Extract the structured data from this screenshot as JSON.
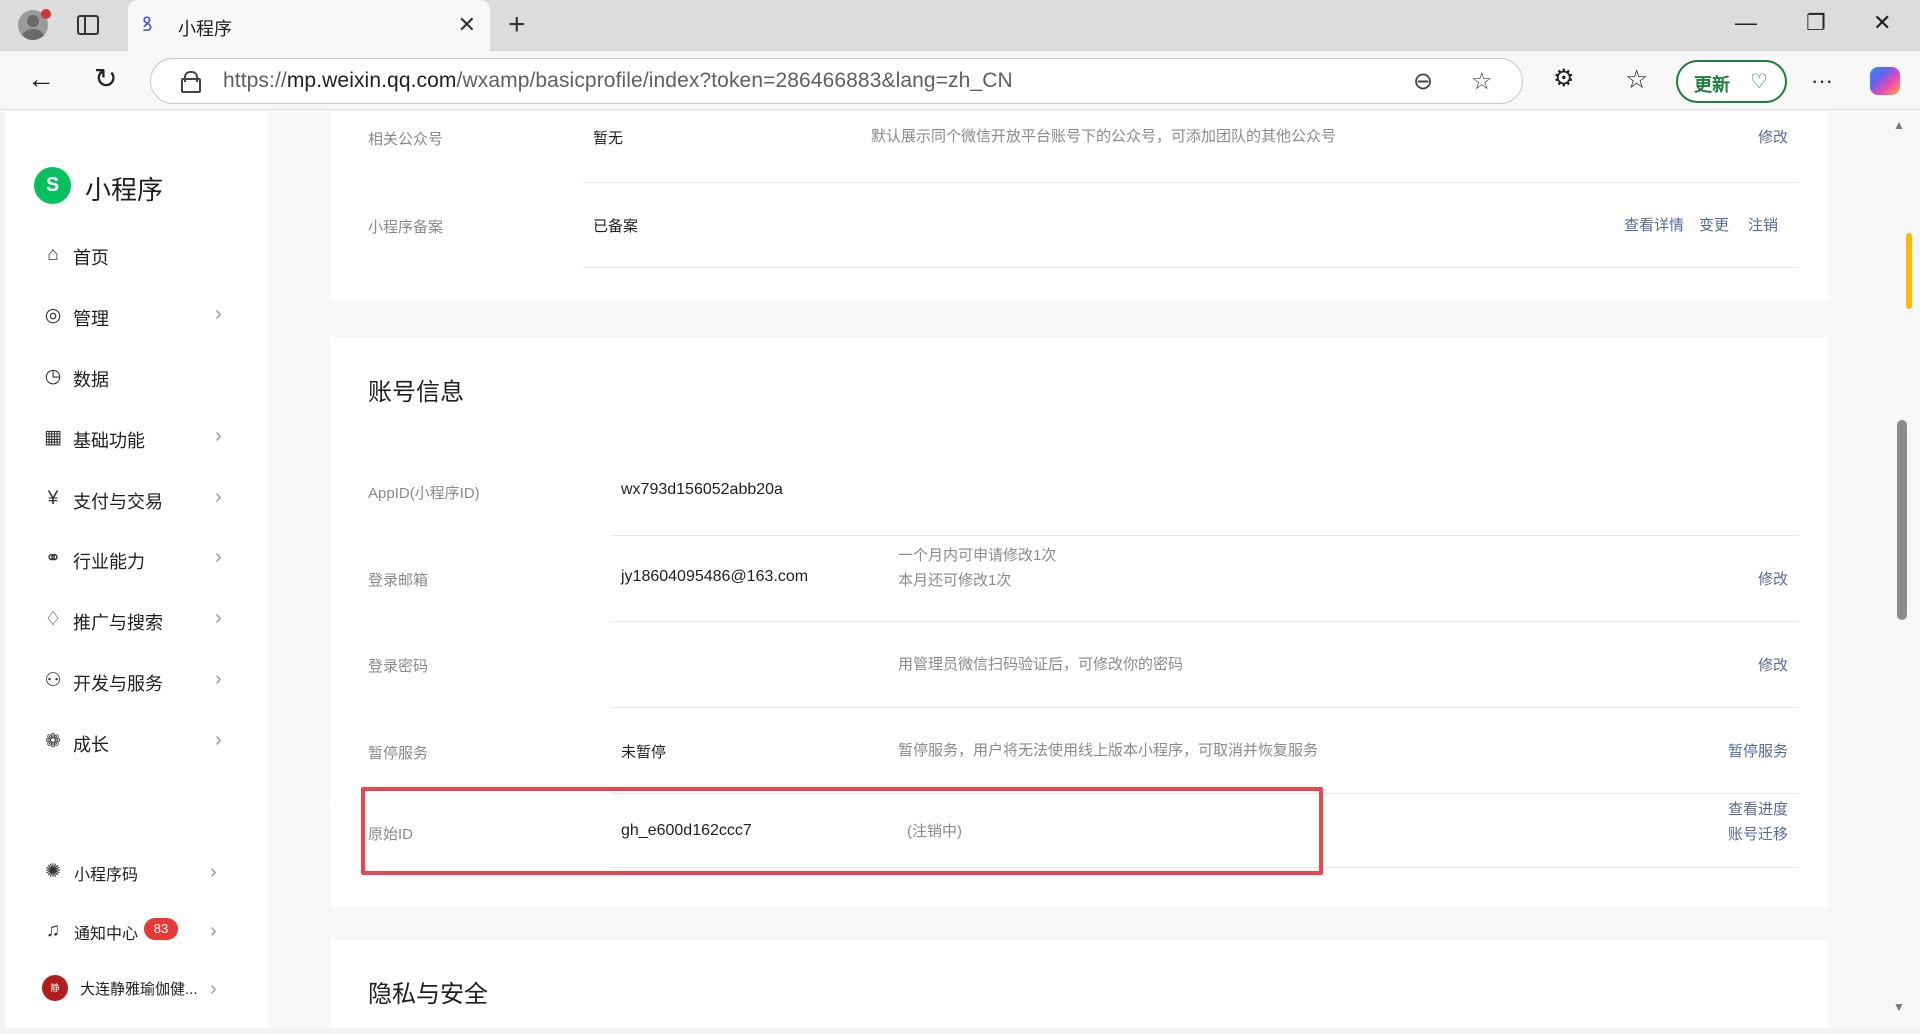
{
  "browser": {
    "tab_title": "小程序",
    "url_prefix": "https://",
    "url_host": "mp.weixin.qq.com",
    "url_path": "/wxamp/basicprofile/index?token=286466883&lang=zh_CN",
    "update_label": "更新",
    "favicon": "ꝸ",
    "close_glyph": "✕",
    "new_tab_glyph": "+",
    "minimize_glyph": "—",
    "restore_glyph": "❐",
    "window_close_glyph": "✕",
    "back_glyph": "←",
    "reload_glyph": "↻",
    "zoom_glyph": "⊖",
    "star_glyph": "☆",
    "extensions_glyph": "⚙",
    "favorites_glyph": "☆",
    "update_icon_glyph": "♡",
    "more_glyph": "···"
  },
  "sidebar": {
    "app_name": "小程序",
    "logo_glyph": "S",
    "items": [
      {
        "label": "首页",
        "icon": "⌂",
        "chevron": ""
      },
      {
        "label": "管理",
        "icon": "◎",
        "chevron": "›"
      },
      {
        "label": "数据",
        "icon": "◷",
        "chevron": ""
      },
      {
        "label": "基础功能",
        "icon": "▦",
        "chevron": "›"
      },
      {
        "label": "支付与交易",
        "icon": "¥",
        "chevron": "›"
      },
      {
        "label": "行业能力",
        "icon": "⚭",
        "chevron": "›"
      },
      {
        "label": "推广与搜索",
        "icon": "♢",
        "chevron": "›"
      },
      {
        "label": "开发与服务",
        "icon": "⚇",
        "chevron": "›"
      },
      {
        "label": "成长",
        "icon": "❁",
        "chevron": "›"
      }
    ],
    "bottom": {
      "qrcode_label": "小程序码",
      "qrcode_icon": "✺",
      "notify_label": "通知中心",
      "notify_icon": "♫",
      "notify_count": "83",
      "account_label": "大连静雅瑜伽健...",
      "account_avatar": "静",
      "chevron": "›"
    }
  },
  "related": {
    "rows": [
      {
        "label": "相关公众号",
        "value": "暂无",
        "desc": "默认展示同个微信开放平台账号下的公众号，可添加团队的其他公众号",
        "link": "修改"
      },
      {
        "label": "小程序备案",
        "value": "已备案",
        "links": [
          "查看详情",
          "变更",
          "注销"
        ]
      }
    ]
  },
  "account": {
    "title": "账号信息",
    "appid_label": "AppID(小程序ID)",
    "appid_value": "wx793d156052abb20a",
    "email_label": "登录邮箱",
    "email_value": "jy18604095486@163.com",
    "email_desc_1": "一个月内可申请修改1次",
    "email_desc_2": "本月还可修改1次",
    "email_link": "修改",
    "password_label": "登录密码",
    "password_desc": "用管理员微信扫码验证后，可修改你的密码",
    "password_link": "修改",
    "pause_label": "暂停服务",
    "pause_value": "未暂停",
    "pause_desc": "暂停服务，用户将无法使用线上版本小程序，可取消并恢复服务",
    "pause_link": "暂停服务",
    "origin_label": "原始ID",
    "origin_value": "gh_e600d162ccc7",
    "origin_desc": "(注销中)",
    "origin_link_1": "查看进度",
    "origin_link_2": "账号迁移"
  },
  "privacy": {
    "title": "隐私与安全"
  },
  "scroll": {
    "up": "▲",
    "down": "▼"
  }
}
